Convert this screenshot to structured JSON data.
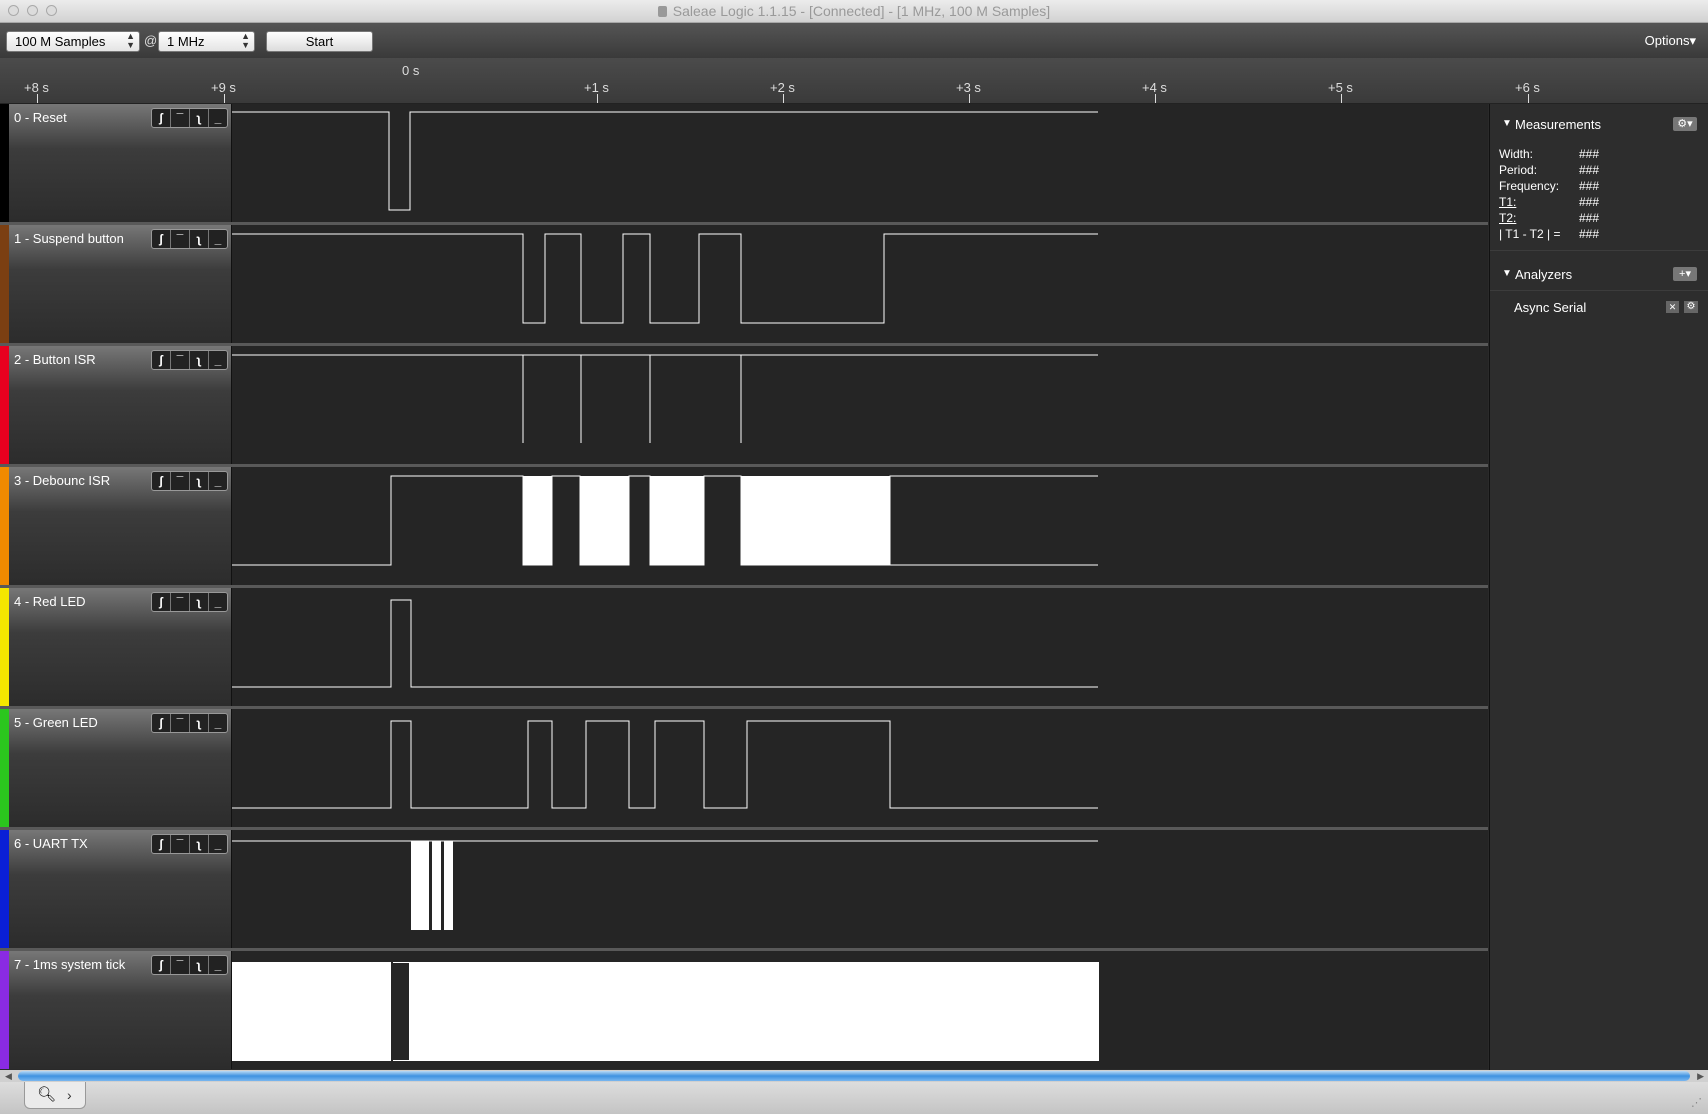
{
  "window": {
    "title": "Saleae Logic 1.1.15 - [Connected] - [1 MHz, 100 M Samples]"
  },
  "toolbar": {
    "samples": "100 M Samples",
    "at": "@",
    "rate": "1 MHz",
    "start_label": "Start",
    "options_label": "Options"
  },
  "ruler": {
    "zero_label": "0 s",
    "ticks": [
      "+8 s",
      "+9 s",
      "+1 s",
      "+2 s",
      "+3 s",
      "+4 s",
      "+5 s",
      "+6 s"
    ]
  },
  "channels": [
    {
      "label": "0 - Reset",
      "color": "#000000"
    },
    {
      "label": "1 - Suspend button",
      "color": "#7b3f12"
    },
    {
      "label": "2 - Button ISR",
      "color": "#e8001f"
    },
    {
      "label": "3 - Debounc ISR",
      "color": "#f08a00"
    },
    {
      "label": "4 - Red LED",
      "color": "#f4e600"
    },
    {
      "label": "5 - Green LED",
      "color": "#2bc61e"
    },
    {
      "label": "6 - UART TX",
      "color": "#0a1fd6"
    },
    {
      "label": "7 - 1ms system tick",
      "color": "#8a2be2"
    }
  ],
  "trigger_icons": [
    "rising-edge-icon",
    "high-level-icon",
    "falling-edge-icon",
    "low-level-icon"
  ],
  "measurements": {
    "title": "Measurements",
    "rows": [
      {
        "label": "Width:",
        "value": "###"
      },
      {
        "label": "Period:",
        "value": "###"
      },
      {
        "label": "Frequency:",
        "value": "###"
      },
      {
        "label": "T1:",
        "value": "###"
      },
      {
        "label": "T2:",
        "value": "###"
      },
      {
        "label": "| T1 - T2 | =",
        "value": "###"
      }
    ]
  },
  "analyzers": {
    "title": "Analyzers",
    "items": [
      "Async Serial"
    ]
  }
}
